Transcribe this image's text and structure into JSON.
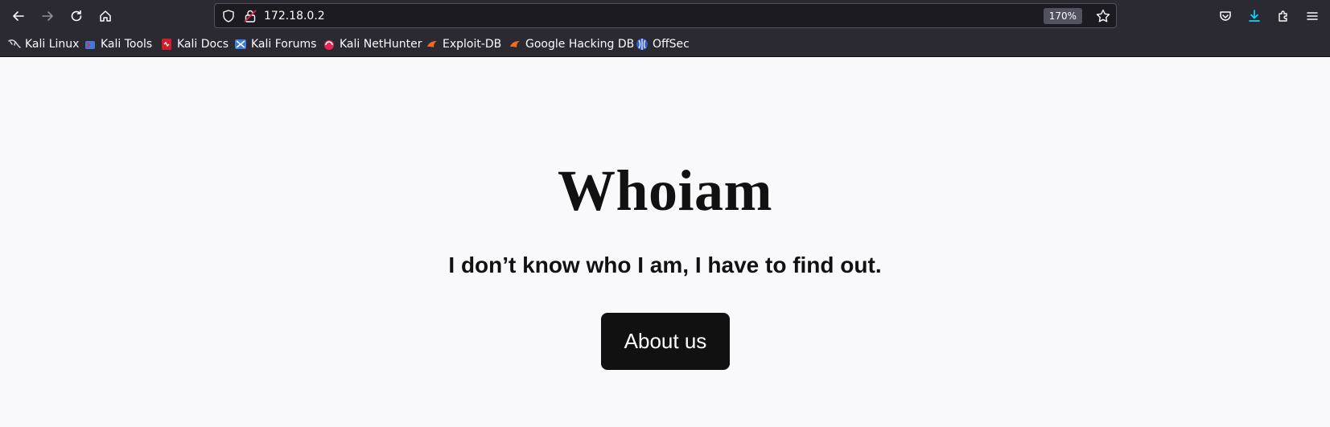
{
  "browser": {
    "url": "172.18.0.2",
    "zoom": "170%",
    "bookmarks": [
      {
        "label": "Kali Linux",
        "icon": "kali-dragon-icon"
      },
      {
        "label": "Kali Tools",
        "icon": "kali-tools-icon"
      },
      {
        "label": "Kali Docs",
        "icon": "kali-docs-icon"
      },
      {
        "label": "Kali Forums",
        "icon": "kali-forums-icon"
      },
      {
        "label": "Kali NetHunter",
        "icon": "kali-nethunter-icon"
      },
      {
        "label": "Exploit-DB",
        "icon": "exploit-db-icon"
      },
      {
        "label": "Google Hacking DB",
        "icon": "ghdb-icon"
      },
      {
        "label": "OffSec",
        "icon": "offsec-icon"
      }
    ],
    "colors": {
      "chrome": "#2b2a33",
      "urlbar": "#1c1b22",
      "download_accent": "#0df"
    }
  },
  "page": {
    "title": "Whoiam",
    "subtitle": "I don’t know who I am, I have to find out.",
    "button_label": "About us",
    "colors": {
      "background": "#f9f9fb",
      "text": "#111111",
      "button": "#111111"
    }
  }
}
